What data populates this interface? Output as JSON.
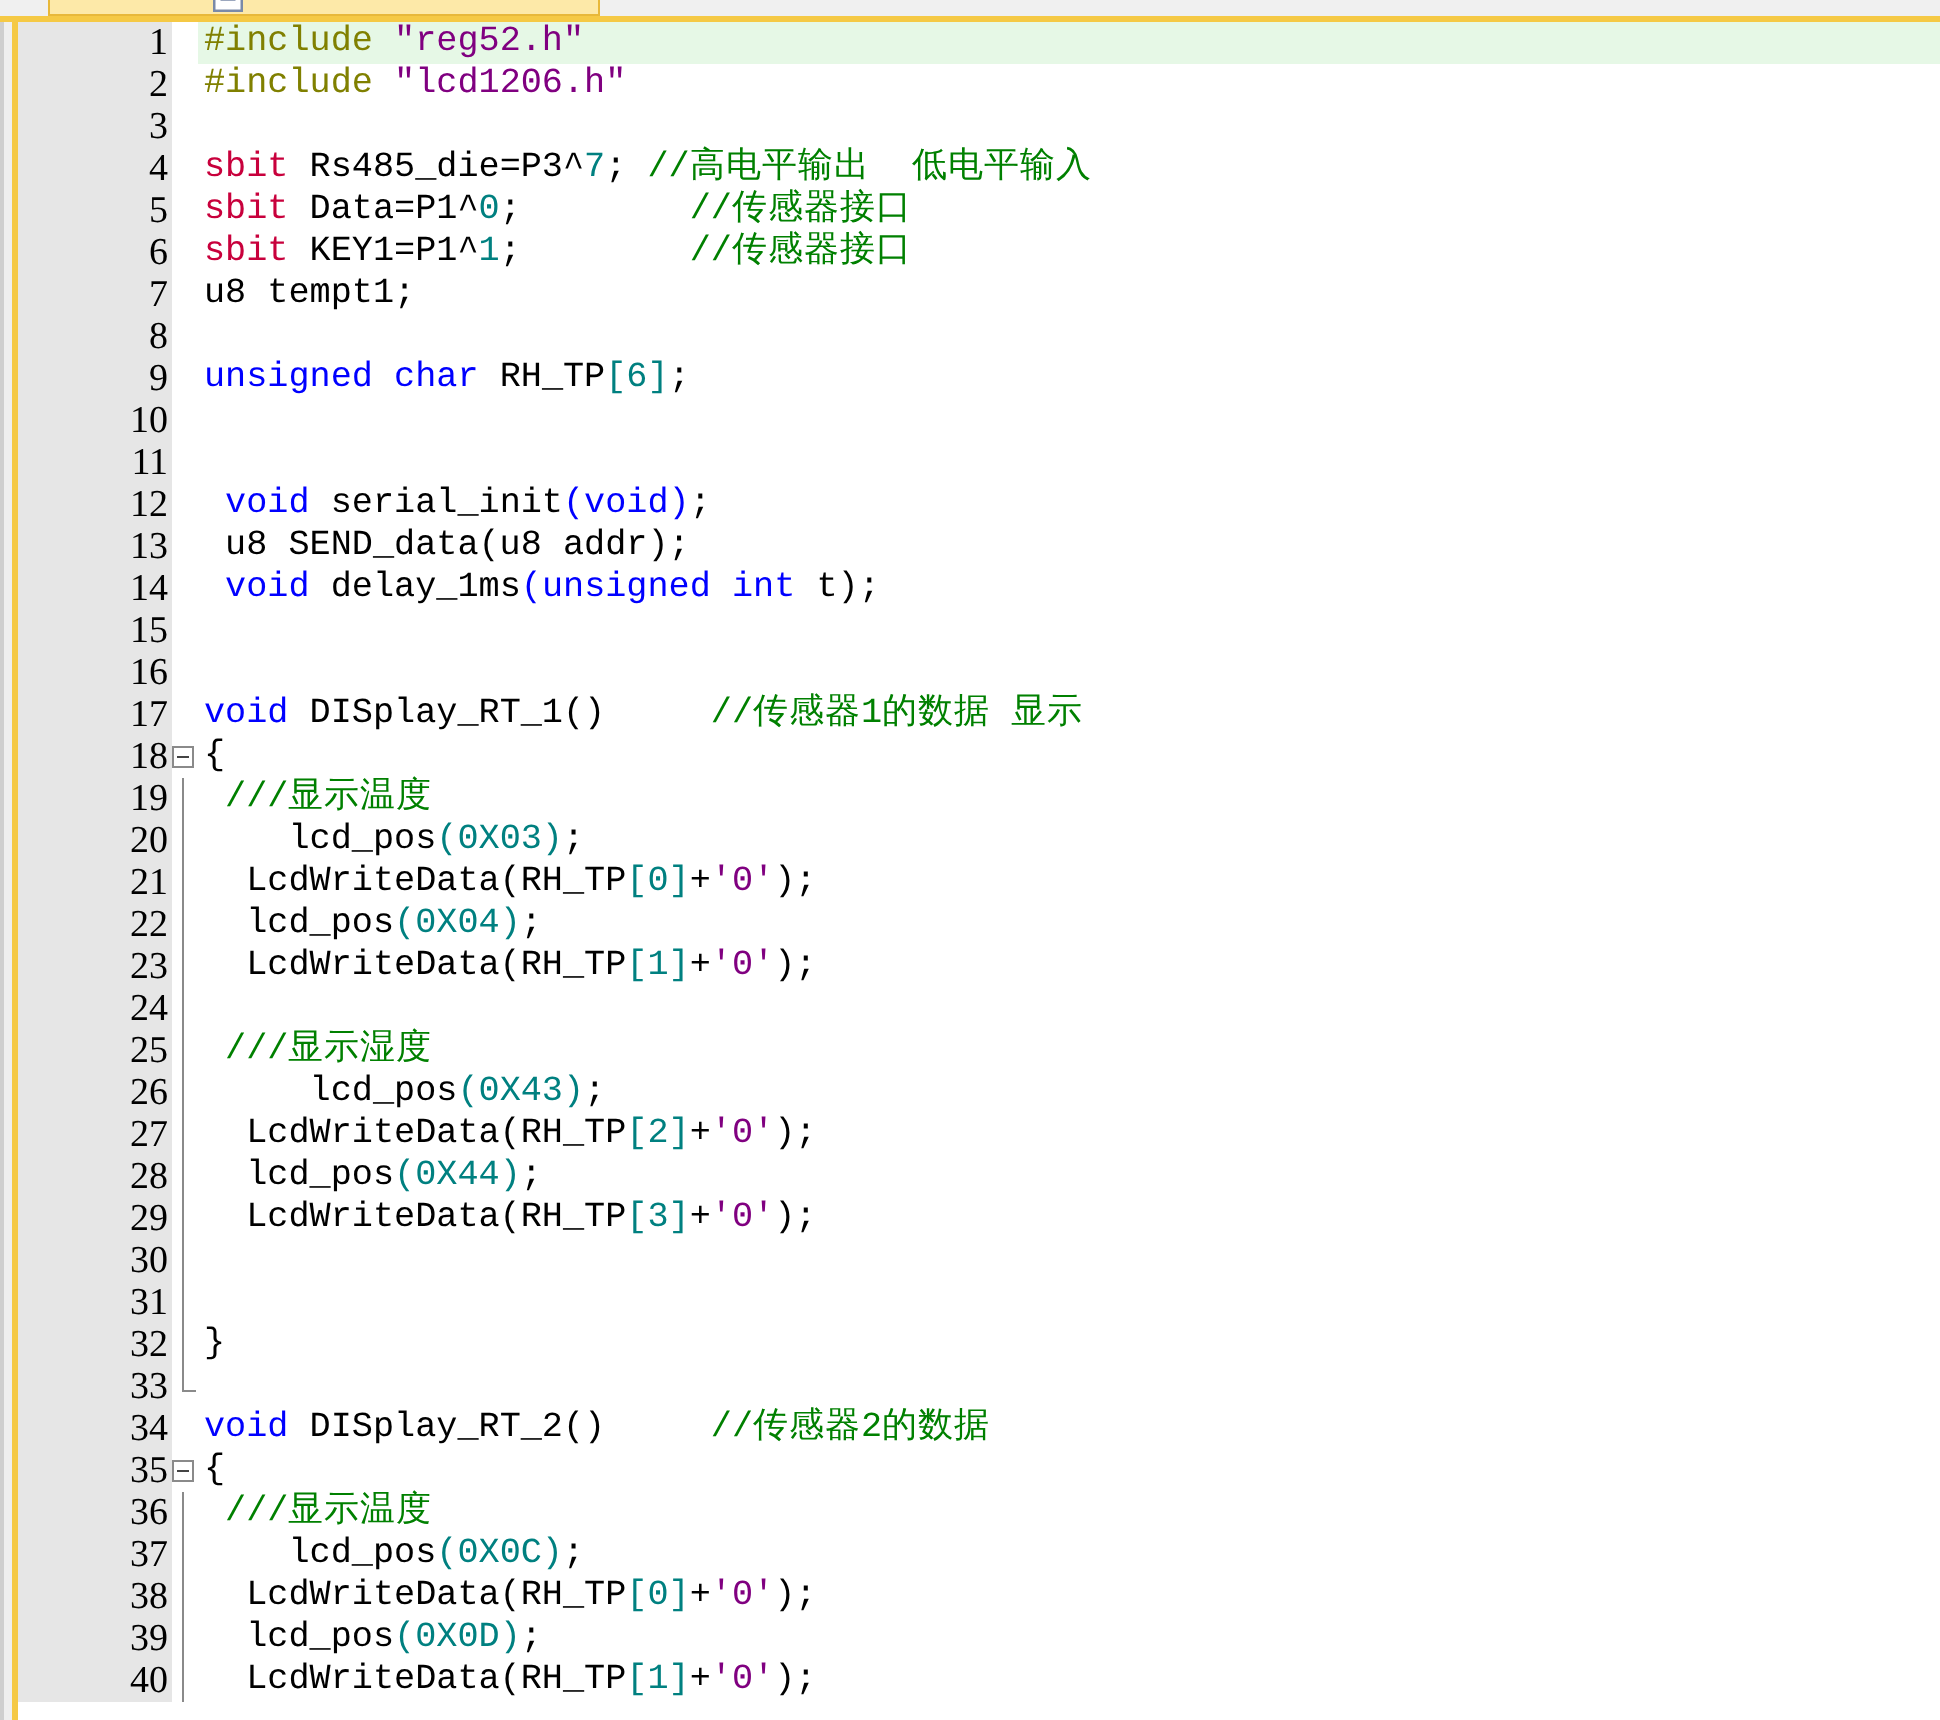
{
  "file_tab": {
    "selected": true
  },
  "editor": {
    "lines": [
      {
        "number": "1",
        "kind": "plain",
        "current": true,
        "tokens": [
          {
            "kind": "pre",
            "text": "#include "
          },
          {
            "kind": "str",
            "text": "\"reg52.h\""
          }
        ]
      },
      {
        "number": "2",
        "kind": "plain",
        "current": false,
        "tokens": [
          {
            "kind": "pre",
            "text": "#include "
          },
          {
            "kind": "str",
            "text": "\"lcd1206.h\""
          }
        ]
      },
      {
        "number": "3",
        "kind": "plain",
        "current": false
      },
      {
        "number": "4",
        "kind": "plain",
        "current": false,
        "tokens": [
          {
            "kind": "sfr",
            "text": "sbit"
          },
          {
            "kind": "plain",
            "text": " Rs485_die=P3^"
          },
          {
            "kind": "num",
            "text": "7"
          },
          {
            "kind": "plain",
            "text": "; "
          },
          {
            "kind": "comment",
            "text": "//高电平输出  低电平输入"
          }
        ]
      },
      {
        "number": "5",
        "kind": "plain",
        "current": false,
        "tokens": [
          {
            "kind": "sfr",
            "text": "sbit"
          },
          {
            "kind": "plain",
            "text": " Data=P1^"
          },
          {
            "kind": "num",
            "text": "0"
          },
          {
            "kind": "plain",
            "text": ";        "
          },
          {
            "kind": "comment",
            "text": "//传感器接口"
          }
        ]
      },
      {
        "number": "6",
        "kind": "plain",
        "current": false,
        "tokens": [
          {
            "kind": "sfr",
            "text": "sbit"
          },
          {
            "kind": "plain",
            "text": " KEY1=P1^"
          },
          {
            "kind": "num",
            "text": "1"
          },
          {
            "kind": "plain",
            "text": ";        "
          },
          {
            "kind": "comment",
            "text": "//传感器接口"
          }
        ]
      },
      {
        "number": "7",
        "kind": "plain",
        "current": false,
        "tokens": [
          {
            "kind": "plain",
            "text": "u8 tempt1;"
          }
        ]
      },
      {
        "number": "8",
        "kind": "plain",
        "current": false
      },
      {
        "number": "9",
        "kind": "plain",
        "current": false,
        "tokens": [
          {
            "kind": "keyword",
            "text": "unsigned char"
          },
          {
            "kind": "plain",
            "text": " RH_TP"
          },
          {
            "kind": "num",
            "text": "[6]"
          },
          {
            "kind": "plain",
            "text": ";"
          }
        ]
      },
      {
        "number": "10",
        "kind": "plain",
        "current": false
      },
      {
        "number": "11",
        "kind": "plain",
        "current": false
      },
      {
        "number": "12",
        "kind": "plain",
        "current": false,
        "tokens": [
          {
            "kind": "keyword",
            "text": " void"
          },
          {
            "kind": "plain",
            "text": " serial_init"
          },
          {
            "kind": "keyword",
            "text": "(void)"
          },
          {
            "kind": "plain",
            "text": ";"
          }
        ]
      },
      {
        "number": "13",
        "kind": "plain",
        "current": false,
        "tokens": [
          {
            "kind": "plain",
            "text": " u8 SEND_data(u8 addr);"
          }
        ]
      },
      {
        "number": "14",
        "kind": "plain",
        "current": false,
        "tokens": [
          {
            "kind": "keyword",
            "text": " void"
          },
          {
            "kind": "plain",
            "text": " delay_1ms"
          },
          {
            "kind": "keyword",
            "text": "(unsigned int"
          },
          {
            "kind": "plain",
            "text": " t);"
          }
        ]
      },
      {
        "number": "15",
        "kind": "plain",
        "current": false
      },
      {
        "number": "16",
        "kind": "plain",
        "current": false
      },
      {
        "number": "17",
        "kind": "plain",
        "current": false,
        "tokens": [
          {
            "kind": "keyword",
            "text": "void"
          },
          {
            "kind": "plain",
            "text": " DISplay_RT_1()     "
          },
          {
            "kind": "comment",
            "text": "//传感器1的数据 显示"
          }
        ]
      },
      {
        "number": "18",
        "kind": "open",
        "current": false,
        "tokens": [
          {
            "kind": "plain",
            "text": "{"
          }
        ]
      },
      {
        "number": "19",
        "kind": "body",
        "current": false,
        "tokens": [
          {
            "kind": "comment",
            "text": " ///显示温度"
          }
        ]
      },
      {
        "number": "20",
        "kind": "body",
        "current": false,
        "tokens": [
          {
            "kind": "plain",
            "text": "    lcd_pos"
          },
          {
            "kind": "num",
            "text": "(0X03)"
          },
          {
            "kind": "plain",
            "text": ";"
          }
        ]
      },
      {
        "number": "21",
        "kind": "body",
        "current": false,
        "tokens": [
          {
            "kind": "plain",
            "text": "  LcdWriteData(RH_TP"
          },
          {
            "kind": "num",
            "text": "[0]"
          },
          {
            "kind": "plain",
            "text": "+"
          },
          {
            "kind": "str",
            "text": "'0'"
          },
          {
            "kind": "plain",
            "text": ");"
          }
        ]
      },
      {
        "number": "22",
        "kind": "body",
        "current": false,
        "tokens": [
          {
            "kind": "plain",
            "text": "  lcd_pos"
          },
          {
            "kind": "num",
            "text": "(0X04)"
          },
          {
            "kind": "plain",
            "text": ";"
          }
        ]
      },
      {
        "number": "23",
        "kind": "body",
        "current": false,
        "tokens": [
          {
            "kind": "plain",
            "text": "  LcdWriteData(RH_TP"
          },
          {
            "kind": "num",
            "text": "[1]"
          },
          {
            "kind": "plain",
            "text": "+"
          },
          {
            "kind": "str",
            "text": "'0'"
          },
          {
            "kind": "plain",
            "text": ");"
          }
        ]
      },
      {
        "number": "24",
        "kind": "body",
        "current": false
      },
      {
        "number": "25",
        "kind": "body",
        "current": false,
        "tokens": [
          {
            "kind": "comment",
            "text": " ///显示湿度"
          }
        ]
      },
      {
        "number": "26",
        "kind": "body",
        "current": false,
        "tokens": [
          {
            "kind": "plain",
            "text": "     lcd_pos"
          },
          {
            "kind": "num",
            "text": "(0X43)"
          },
          {
            "kind": "plain",
            "text": ";"
          }
        ]
      },
      {
        "number": "27",
        "kind": "body",
        "current": false,
        "tokens": [
          {
            "kind": "plain",
            "text": "  LcdWriteData(RH_TP"
          },
          {
            "kind": "num",
            "text": "[2]"
          },
          {
            "kind": "plain",
            "text": "+"
          },
          {
            "kind": "str",
            "text": "'0'"
          },
          {
            "kind": "plain",
            "text": ");"
          }
        ]
      },
      {
        "number": "28",
        "kind": "body",
        "current": false,
        "tokens": [
          {
            "kind": "plain",
            "text": "  lcd_pos"
          },
          {
            "kind": "num",
            "text": "(0X44)"
          },
          {
            "kind": "plain",
            "text": ";"
          }
        ]
      },
      {
        "number": "29",
        "kind": "body",
        "current": false,
        "tokens": [
          {
            "kind": "plain",
            "text": "  LcdWriteData(RH_TP"
          },
          {
            "kind": "num",
            "text": "[3]"
          },
          {
            "kind": "plain",
            "text": "+"
          },
          {
            "kind": "str",
            "text": "'0'"
          },
          {
            "kind": "plain",
            "text": ");"
          }
        ]
      },
      {
        "number": "30",
        "kind": "body",
        "current": false
      },
      {
        "number": "31",
        "kind": "body",
        "current": false
      },
      {
        "number": "32",
        "kind": "body",
        "current": false,
        "tokens": [
          {
            "kind": "plain",
            "text": "}"
          }
        ]
      },
      {
        "number": "33",
        "kind": "end",
        "current": false
      },
      {
        "number": "34",
        "kind": "plain",
        "current": false,
        "tokens": [
          {
            "kind": "keyword",
            "text": "void"
          },
          {
            "kind": "plain",
            "text": " DISplay_RT_2()     "
          },
          {
            "kind": "comment",
            "text": "//传感器2的数据"
          }
        ]
      },
      {
        "number": "35",
        "kind": "open",
        "current": false,
        "tokens": [
          {
            "kind": "plain",
            "text": "{"
          }
        ]
      },
      {
        "number": "36",
        "kind": "body",
        "current": false,
        "tokens": [
          {
            "kind": "comment",
            "text": " ///显示温度"
          }
        ]
      },
      {
        "number": "37",
        "kind": "body",
        "current": false,
        "tokens": [
          {
            "kind": "plain",
            "text": "    lcd_pos"
          },
          {
            "kind": "num",
            "text": "(0X0C)"
          },
          {
            "kind": "plain",
            "text": ";"
          }
        ]
      },
      {
        "number": "38",
        "kind": "body",
        "current": false,
        "tokens": [
          {
            "kind": "plain",
            "text": "  LcdWriteData(RH_TP"
          },
          {
            "kind": "num",
            "text": "[0]"
          },
          {
            "kind": "plain",
            "text": "+"
          },
          {
            "kind": "str",
            "text": "'0'"
          },
          {
            "kind": "plain",
            "text": ");"
          }
        ]
      },
      {
        "number": "39",
        "kind": "body",
        "current": false,
        "tokens": [
          {
            "kind": "plain",
            "text": "  lcd_pos"
          },
          {
            "kind": "num",
            "text": "(0X0D)"
          },
          {
            "kind": "plain",
            "text": ";"
          }
        ]
      },
      {
        "number": "40",
        "kind": "body",
        "current": false,
        "tokens": [
          {
            "kind": "plain",
            "text": "  LcdWriteData(RH_TP"
          },
          {
            "kind": "num",
            "text": "[1]"
          },
          {
            "kind": "plain",
            "text": "+"
          },
          {
            "kind": "str",
            "text": "'0'"
          },
          {
            "kind": "plain",
            "text": ");"
          }
        ]
      }
    ]
  }
}
